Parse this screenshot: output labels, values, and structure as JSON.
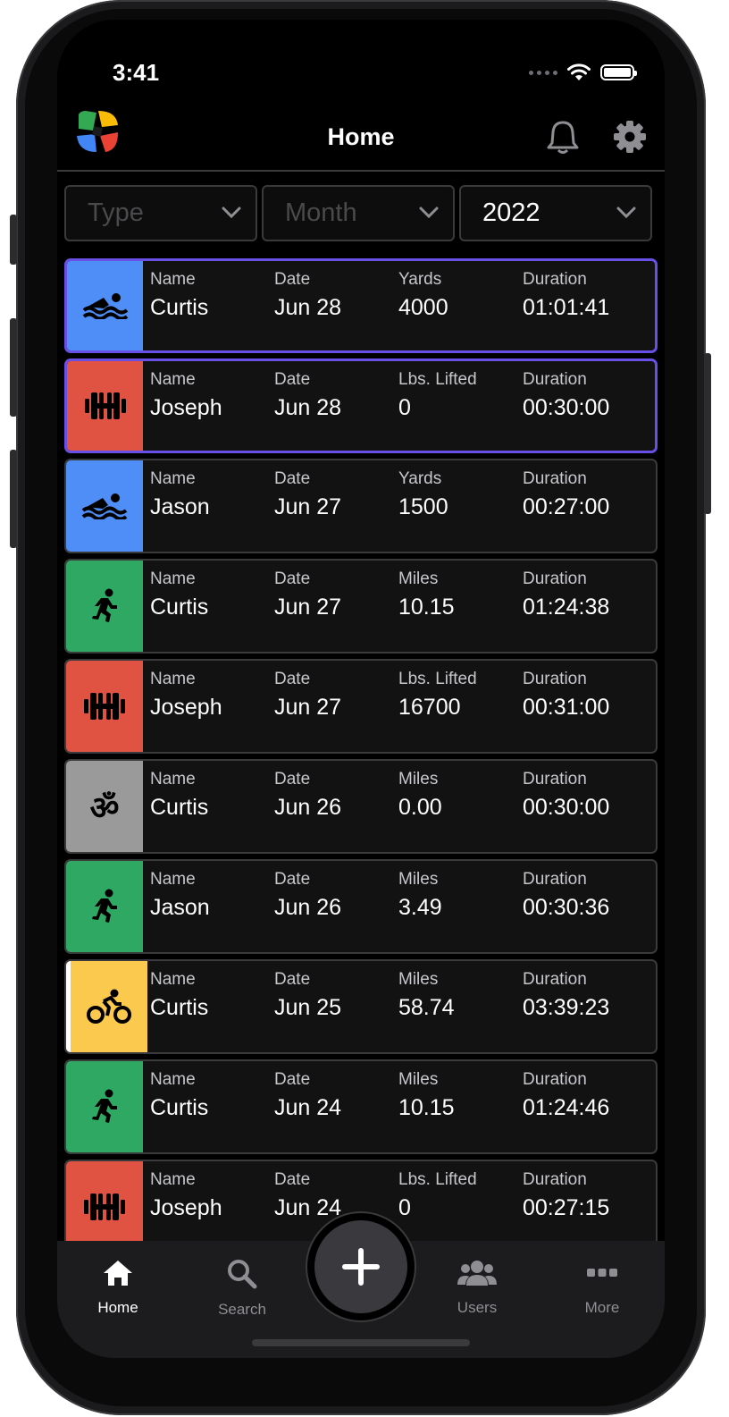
{
  "status": {
    "time": "3:41"
  },
  "header": {
    "title": "Home"
  },
  "filters": [
    {
      "text": "Type",
      "placeholder": true
    },
    {
      "text": "Month",
      "placeholder": true
    },
    {
      "text": "2022",
      "placeholder": false
    }
  ],
  "activities": [
    {
      "sport": "swim",
      "icon": "swimming-icon",
      "color": "#4f8ef7",
      "name_label": "Name",
      "name": "Curtis",
      "date_label": "Date",
      "date": "Jun 28",
      "metric_label": "Yards",
      "metric": "4000",
      "duration_label": "Duration",
      "duration": "01:01:41",
      "selected": true
    },
    {
      "sport": "weights",
      "icon": "dumbbell-icon",
      "color": "#e05242",
      "name_label": "Name",
      "name": "Joseph",
      "date_label": "Date",
      "date": "Jun 28",
      "metric_label": "Lbs. Lifted",
      "metric": "0",
      "duration_label": "Duration",
      "duration": "00:30:00",
      "selected": true
    },
    {
      "sport": "swim",
      "icon": "swimming-icon",
      "color": "#4f8ef7",
      "name_label": "Name",
      "name": "Jason",
      "date_label": "Date",
      "date": "Jun 27",
      "metric_label": "Yards",
      "metric": "1500",
      "duration_label": "Duration",
      "duration": "00:27:00",
      "selected": false
    },
    {
      "sport": "run",
      "icon": "running-icon",
      "color": "#2ea862",
      "name_label": "Name",
      "name": "Curtis",
      "date_label": "Date",
      "date": "Jun 27",
      "metric_label": "Miles",
      "metric": "10.15",
      "duration_label": "Duration",
      "duration": "01:24:38",
      "selected": false
    },
    {
      "sport": "weights",
      "icon": "dumbbell-icon",
      "color": "#e05242",
      "name_label": "Name",
      "name": "Joseph",
      "date_label": "Date",
      "date": "Jun 27",
      "metric_label": "Lbs. Lifted",
      "metric": "16700",
      "duration_label": "Duration",
      "duration": "00:31:00",
      "selected": false
    },
    {
      "sport": "yoga",
      "icon": "om-icon",
      "color": "#9a9a9a",
      "name_label": "Name",
      "name": "Curtis",
      "date_label": "Date",
      "date": "Jun 26",
      "metric_label": "Miles",
      "metric": "0.00",
      "duration_label": "Duration",
      "duration": "00:30:00",
      "selected": false
    },
    {
      "sport": "run",
      "icon": "running-icon",
      "color": "#2ea862",
      "name_label": "Name",
      "name": "Jason",
      "date_label": "Date",
      "date": "Jun 26",
      "metric_label": "Miles",
      "metric": "3.49",
      "duration_label": "Duration",
      "duration": "00:30:36",
      "selected": false
    },
    {
      "sport": "bike",
      "icon": "cycling-icon",
      "color": "#fbc94e",
      "name_label": "Name",
      "name": "Curtis",
      "date_label": "Date",
      "date": "Jun 25",
      "metric_label": "Miles",
      "metric": "58.74",
      "duration_label": "Duration",
      "duration": "03:39:23",
      "selected": false
    },
    {
      "sport": "run",
      "icon": "running-icon",
      "color": "#2ea862",
      "name_label": "Name",
      "name": "Curtis",
      "date_label": "Date",
      "date": "Jun 24",
      "metric_label": "Miles",
      "metric": "10.15",
      "duration_label": "Duration",
      "duration": "01:24:46",
      "selected": false
    },
    {
      "sport": "weights",
      "icon": "dumbbell-icon",
      "color": "#e05242",
      "name_label": "Name",
      "name": "Joseph",
      "date_label": "Date",
      "date": "Jun 24",
      "metric_label": "Lbs. Lifted",
      "metric": "0",
      "duration_label": "Duration",
      "duration": "00:27:15",
      "selected": false
    }
  ],
  "tabbar": {
    "home": "Home",
    "search": "Search",
    "users": "Users",
    "more": "More"
  },
  "colors": {
    "accent_selected": "#6a4fe6",
    "background": "#000000",
    "card": "#121212"
  }
}
